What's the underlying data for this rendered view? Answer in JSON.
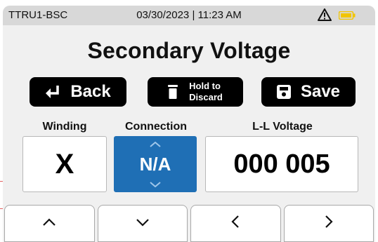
{
  "status": {
    "device": "TTRU1-BSC",
    "datetime": "03/30/2023 | 11:23 AM",
    "warning_icon": "warning-triangle-icon",
    "battery_icon": "battery-icon",
    "battery_color": "#f2c500"
  },
  "title": "Secondary Voltage",
  "buttons": {
    "back": "Back",
    "discard_line1": "Hold to",
    "discard_line2": "Discard",
    "save": "Save"
  },
  "fields": {
    "winding": {
      "label": "Winding",
      "value": "X"
    },
    "connection": {
      "label": "Connection",
      "value": "N/A"
    },
    "voltage": {
      "label": "L-L Voltage",
      "value": "000 005"
    }
  },
  "nav": {
    "up": "up-chevron-icon",
    "down": "down-chevron-icon",
    "left": "left-chevron-icon",
    "right": "right-chevron-icon"
  },
  "colors": {
    "connection_active": "#1f6fb5",
    "button": "#000000"
  }
}
